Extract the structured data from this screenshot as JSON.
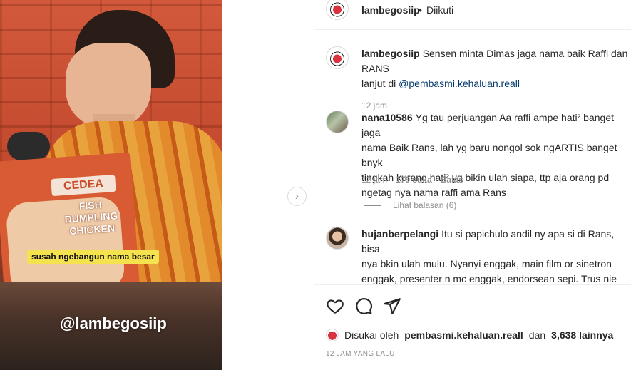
{
  "video": {
    "subtitle": "susah ngebangun nama besar",
    "watermark": "@lambegosiip",
    "bag_brand": "CEDEA",
    "bag_text": "FISH\nDUMPLING\nCHICKEN"
  },
  "header": {
    "username": "lambegosiip",
    "separator": "•",
    "follow_status": "Diikuti"
  },
  "comments": [
    {
      "username": "lambegosiip",
      "text": "Sensen minta Dimas jaga nama baik Raffi dan RANS",
      "text_line2": "lanjut di ",
      "mention": "@pembasmi.kehaluan.reall",
      "time": "12 jam"
    },
    {
      "username": "nana10586",
      "text": "Yg tau perjuangan Aa raffi ampe hati² banget jaga\nnama Baik Rans, lah yg baru nongol sok ngARTIS banget bnyk\ntingkah kurang hati²,yg bikin ulah siapa, ttp aja orang pd\nngetag nya nama raffi ama Rans",
      "time": "12 jam",
      "likes": "179 suka",
      "reply": "Balas",
      "view_replies": "Lihat balasan (6)"
    },
    {
      "username": "hujanberpelangi",
      "text": "Itu si papichulo andil ny apa si di Rans, bisa\nnya bkin ulah mulu. Nyanyi enggak, main film or sinetron\nenggak, presenter n mc enggak, endorsean sepi. Trus nie anak\nkerja apa disono? Masak pling mentok prestasi nya ciman\nbullian trus nyalahin orang lain pula karna... Gak"
    }
  ],
  "actions": {
    "like_icon": "heart-icon",
    "comment_icon": "comment-icon",
    "share_icon": "send-icon",
    "liked_by_prefix": "Disukai oleh",
    "liked_by_user": "pembasmi.kehaluan.reall",
    "liked_by_and": "dan",
    "liked_by_count": "3,638 lainnya",
    "timestamp": "12 JAM YANG LALU"
  }
}
